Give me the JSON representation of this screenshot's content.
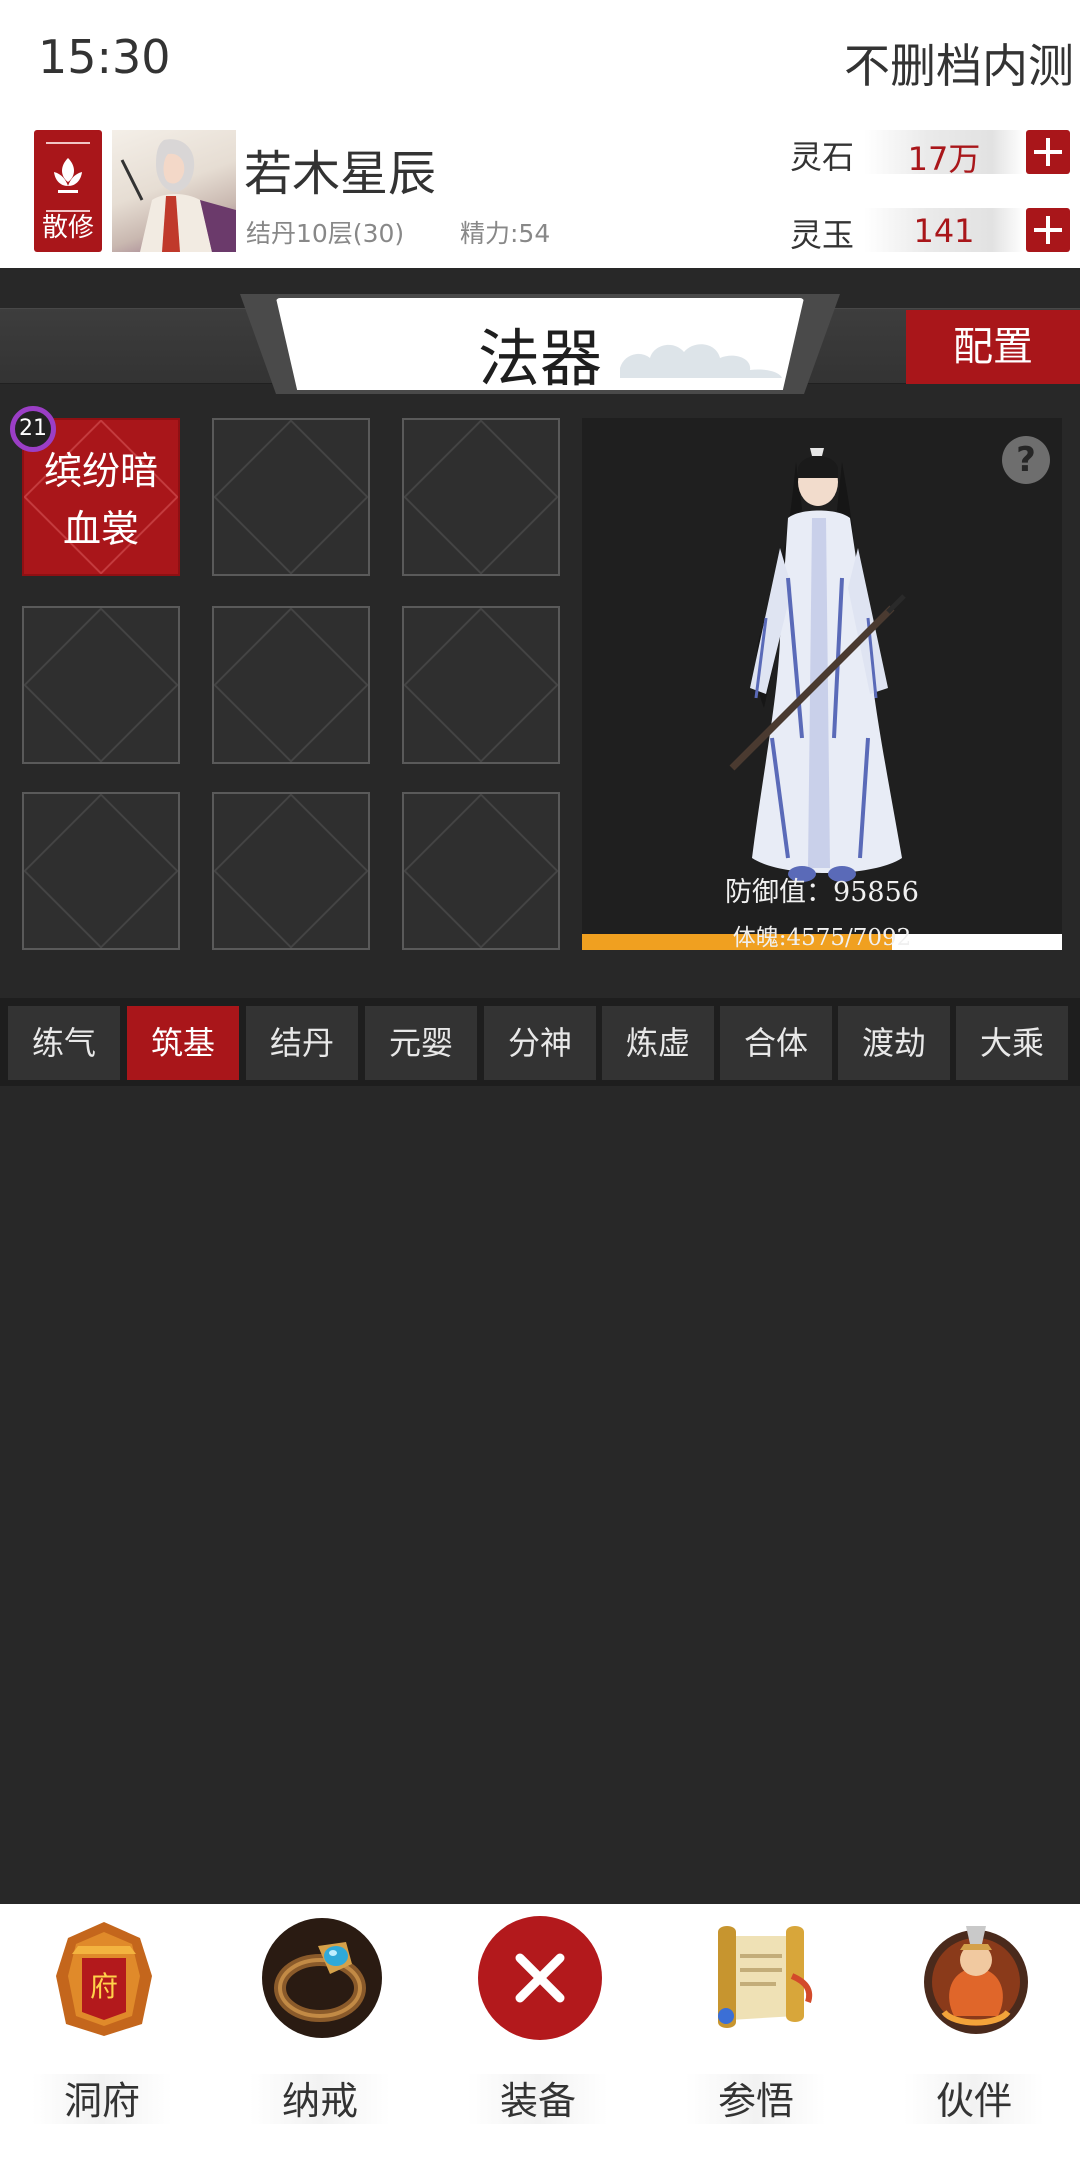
{
  "status": {
    "time": "15:30",
    "server": "不删档内测"
  },
  "player": {
    "sect": "散修",
    "name": "若木星辰",
    "level": "结丹10层(30)",
    "energy": "精力:54"
  },
  "currencies": [
    {
      "label": "灵石",
      "value": "17万"
    },
    {
      "label": "灵玉",
      "value": "141"
    }
  ],
  "page": {
    "title": "法器",
    "config_label": "配置"
  },
  "equipment": {
    "slots": [
      {
        "name": "缤纷暗血裳",
        "level": "21",
        "filled": true
      },
      {
        "name": "",
        "filled": false
      },
      {
        "name": "",
        "filled": false
      },
      {
        "name": "",
        "filled": false
      },
      {
        "name": "",
        "filled": false
      },
      {
        "name": "",
        "filled": false
      },
      {
        "name": "",
        "filled": false
      },
      {
        "name": "",
        "filled": false
      },
      {
        "name": "",
        "filled": false
      }
    ]
  },
  "preview": {
    "defense": "防御值：95856",
    "hp": "体魄:4575/7092",
    "hp_fraction": 0.645
  },
  "realm_tabs": {
    "items": [
      "练气",
      "筑基",
      "结丹",
      "元婴",
      "分神",
      "炼虚",
      "合体",
      "渡劫",
      "大乘"
    ],
    "active_index": 1
  },
  "bottom_nav": [
    {
      "label": "洞府",
      "icon": "cave-mansion-icon"
    },
    {
      "label": "纳戒",
      "icon": "storage-ring-icon"
    },
    {
      "label": "装备",
      "icon": "close-icon"
    },
    {
      "label": "参悟",
      "icon": "scroll-icon"
    },
    {
      "label": "伙伴",
      "icon": "companion-icon"
    }
  ],
  "colors": {
    "accent": "#a9161a",
    "hp_bar": "#f0a020",
    "level_badge": "#9b3ec6"
  }
}
